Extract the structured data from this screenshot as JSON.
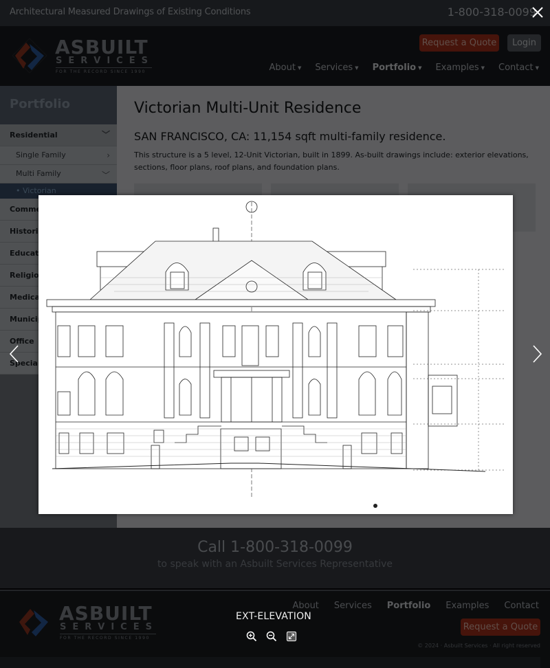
{
  "topbar": {
    "tagline": "Architectural Measured Drawings of Existing Conditions",
    "phone": "1-800-318-0099"
  },
  "brand": {
    "name": "ASBUILT",
    "sub": "SERVICES",
    "tagline": "FOR THE RECORD SINCE 1990",
    "colors": {
      "red": "#b0341c",
      "blue": "#2f5fa8"
    }
  },
  "header": {
    "quote_label": "Request a Quote",
    "login_label": "Login",
    "nav": [
      {
        "label": "About",
        "active": false
      },
      {
        "label": "Services",
        "active": false
      },
      {
        "label": "Portfolio",
        "active": true
      },
      {
        "label": "Examples",
        "active": false
      },
      {
        "label": "Contact",
        "active": false
      }
    ]
  },
  "sidebar": {
    "title": "Portfolio",
    "items": [
      {
        "label": "Residential",
        "state": "expanded"
      },
      {
        "label": "Single Family",
        "state": "collapsed",
        "level": 2
      },
      {
        "label": "Multi Family",
        "state": "expanded",
        "level": 2
      },
      {
        "label": "Victorian",
        "state": "active",
        "level": 3
      },
      {
        "label": "Commercial"
      },
      {
        "label": "Historic"
      },
      {
        "label": "Education"
      },
      {
        "label": "Religious"
      },
      {
        "label": "Medical"
      },
      {
        "label": "Municipal"
      },
      {
        "label": "Office"
      },
      {
        "label": "Special"
      }
    ]
  },
  "article": {
    "title": "Victorian Multi-Unit Residence",
    "subtitle": "SAN FRANCISCO, CA: 11,154 sqft multi-family residence.",
    "body": "This structure is a 5 level, 12-Unit Victorian, built in 1899. As-built drawings include: exterior elevations, sections, floor plans, roof plans, and foundation plans."
  },
  "callbar": {
    "title": "Call 1-800-318-0099",
    "subtitle": "to speak with an Asbuilt Services Representative"
  },
  "footer": {
    "nav": [
      {
        "label": "About",
        "active": false
      },
      {
        "label": "Services",
        "active": false
      },
      {
        "label": "Portfolio",
        "active": true
      },
      {
        "label": "Examples",
        "active": false
      },
      {
        "label": "Contact",
        "active": false
      }
    ],
    "quote_label": "Request a Quote",
    "copyright": "© 2024 · Asbuilt Services · All right reserved"
  },
  "lightbox": {
    "caption": "EXT-ELEVATION",
    "image_alt": "Exterior elevation drawing of Victorian multi-unit residence",
    "close_icon": "close-icon",
    "prev_icon": "chevron-left-icon",
    "next_icon": "chevron-right-icon",
    "tools": [
      {
        "name": "zoom-in",
        "icon": "zoom-in-icon"
      },
      {
        "name": "zoom-out",
        "icon": "zoom-out-icon"
      },
      {
        "name": "fullscreen",
        "icon": "expand-icon"
      }
    ]
  }
}
